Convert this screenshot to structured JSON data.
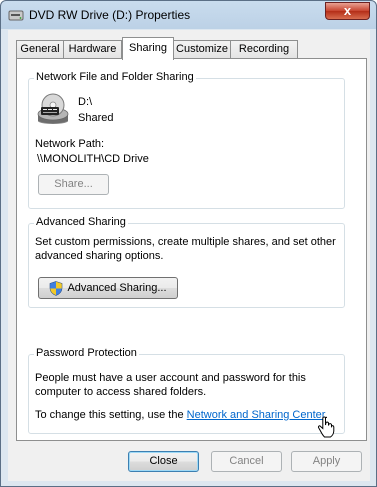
{
  "window": {
    "title": "DVD RW Drive (D:) Properties",
    "close_glyph": "x"
  },
  "tabs": [
    {
      "label": "General"
    },
    {
      "label": "Hardware"
    },
    {
      "label": "Sharing"
    },
    {
      "label": "Customize"
    },
    {
      "label": "Recording"
    }
  ],
  "active_tab": "Sharing",
  "network_sharing": {
    "title": "Network File and Folder Sharing",
    "drive_name": "D:\\",
    "status": "Shared",
    "path_label": "Network Path:",
    "path_value": "\\\\MONOLITH\\CD Drive",
    "share_button": "Share..."
  },
  "advanced_sharing": {
    "title": "Advanced Sharing",
    "description_line1": "Set custom permissions, create multiple shares, and set other",
    "description_line2": "advanced sharing options.",
    "button": "Advanced Sharing..."
  },
  "password_protection": {
    "title": "Password Protection",
    "line1": "People must have a user account and password for this",
    "line2": "computer to access shared folders.",
    "change_prefix": "To change this setting, use the ",
    "link": "Network and Sharing Center",
    "change_suffix": "."
  },
  "footer": {
    "close": "Close",
    "cancel": "Cancel",
    "apply": "Apply"
  },
  "colors": {
    "link": "#0066cc",
    "panel_bg": "#ffffff",
    "dialog_bg": "#f0f0f0"
  }
}
